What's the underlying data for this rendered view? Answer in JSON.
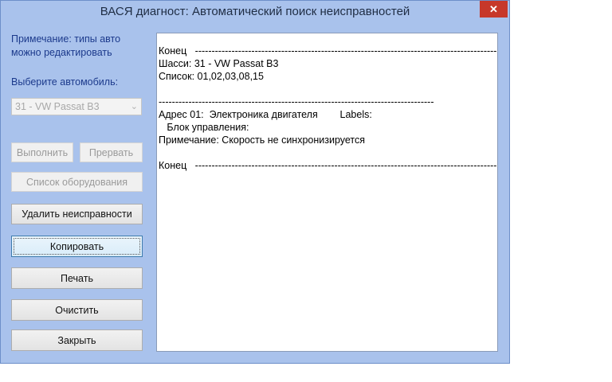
{
  "window": {
    "title": "ВАСЯ диагност: Автоматический поиск неисправностей",
    "close_label": "✕"
  },
  "sidebar": {
    "note_line1": "Примечание: типы авто",
    "note_line2": "можно редактировать",
    "select_label": "Выберите автомобиль:",
    "selected_car": "31 - VW Passat B3"
  },
  "buttons": {
    "run": "Выполнить",
    "abort": "Прервать",
    "equipment": "Список оборудования",
    "clear_faults": "Удалить неисправности",
    "copy": "Копировать",
    "print": "Печать",
    "clear": "Очистить",
    "close": "Закрыть"
  },
  "log": {
    "lines": [
      "Конец   ----------------------------------------------------------------------------------------------------",
      "Шасси: 31 - VW Passat B3",
      "Список: 01,02,03,08,15",
      "",
      "-----------------------------------------------------------------------------------",
      "Адрес 01:  Электроника двигателя        Labels:",
      "   Блок управления:",
      "Примечание: Скорость не синхронизируется",
      "",
      "Конец   ----------------------------------------------------------------------------------------------------"
    ]
  }
}
